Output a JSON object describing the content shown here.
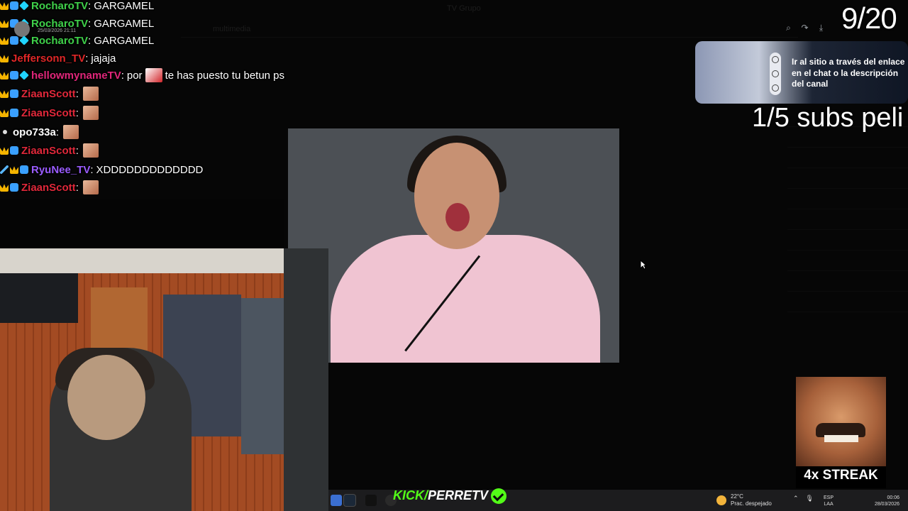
{
  "background_app": {
    "window_title": "TV Grupo",
    "toolbar_label": "multimedia"
  },
  "chat": {
    "messages": [
      {
        "user": "RocharoTV",
        "user_color": "#3fd14a",
        "text": "GARGAMEL"
      },
      {
        "user": "RocharoTV",
        "user_color": "#3fd14a",
        "text": "GARGAMEL"
      },
      {
        "user": "RocharoTV",
        "user_color": "#3fd14a",
        "text": "GARGAMEL"
      },
      {
        "user": "Jeffersonn_TV",
        "user_color": "#e02727",
        "text": "jajaja"
      },
      {
        "user": "hellowmynameTV",
        "user_color": "#e0267a",
        "text_before": "por",
        "text_after": "te has puesto tu betun ps"
      },
      {
        "user": "ZiaanScott",
        "user_color": "#e0283a",
        "text": ""
      },
      {
        "user": "ZiaanScott",
        "user_color": "#e0283a",
        "text": ""
      },
      {
        "user": "opo733a",
        "user_color": "#ffffff",
        "text": ""
      },
      {
        "user": "ZiaanScott",
        "user_color": "#e0283a",
        "text": ""
      },
      {
        "user": "RyuNee_TV",
        "user_color": "#9a5cff",
        "text": "XDDDDDDDDDDDDD"
      },
      {
        "user": "ZiaanScott",
        "user_color": "#e0283a",
        "text": ""
      }
    ],
    "overlay_timestamp": "25/03/2026 21:11"
  },
  "overlay": {
    "counter": "9/20",
    "subs_goal": "1/5 subs peli",
    "promo_text": "Ir al sitio a través del enlace en el chat o la descripción del canal",
    "streak_label": "4x STREAK"
  },
  "branding": {
    "kick_prefix": "KICK/",
    "channel": "PERRETV",
    "accent": "#53fc18"
  },
  "taskbar": {
    "temperature": "22°C",
    "weather": "Prac. despejado",
    "lang_top": "ESP",
    "lang_bottom": "LAA",
    "time": "00:06",
    "date": "28/03/2026"
  }
}
